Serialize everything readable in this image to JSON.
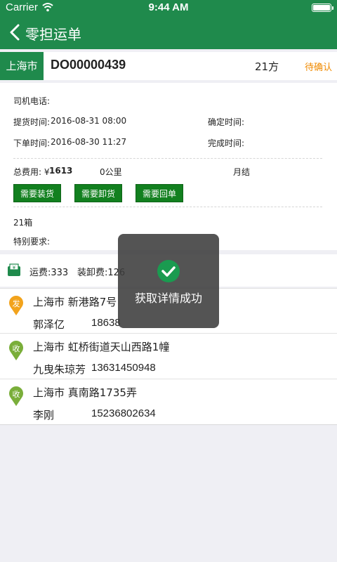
{
  "status_bar": {
    "carrier": "Carrier",
    "time": "9:44 AM"
  },
  "nav": {
    "title": "零担运单"
  },
  "order": {
    "city": "上海市",
    "number": "DO00000439",
    "volume": "21方",
    "status": "待确认"
  },
  "details": {
    "driver_phone_label": "司机电话:",
    "pickup_time_label": "提货时间:",
    "pickup_time": "2016-08-31 08:00",
    "confirm_time_label": "确定时间:",
    "order_time_label": "下单时间:",
    "order_time": "2016-08-30 11:27",
    "complete_time_label": "完成时间:",
    "total_fee_label": "总费用: ¥",
    "total_fee": "1613",
    "distance": "0公里",
    "payment": "月结",
    "buttons": [
      "需要装货",
      "需要卸货",
      "需要回单"
    ],
    "package_count": "21箱",
    "special_label": "特别要求:"
  },
  "freight": {
    "freight_fee": "运费:333",
    "handling_fee": "装卸费:126"
  },
  "stops": [
    {
      "tag": "发",
      "address": "上海市 新港路7号",
      "name": "郭泽亿",
      "phone": "18638"
    },
    {
      "tag": "收",
      "address": "上海市 虹桥街道天山西路1幢",
      "name": "九曳朱琼芳",
      "phone": "13631450948"
    },
    {
      "tag": "收",
      "address": "上海市 真南路1735弄",
      "name": "李刚",
      "phone": "15236802634"
    }
  ],
  "toast": {
    "message": "获取详情成功"
  },
  "colors": {
    "brand_green": "#1f8a4c",
    "button_green": "#12801f",
    "status_orange": "#f08a00",
    "pin_orange": "#f2a31c",
    "pin_green": "#7aae3a"
  }
}
